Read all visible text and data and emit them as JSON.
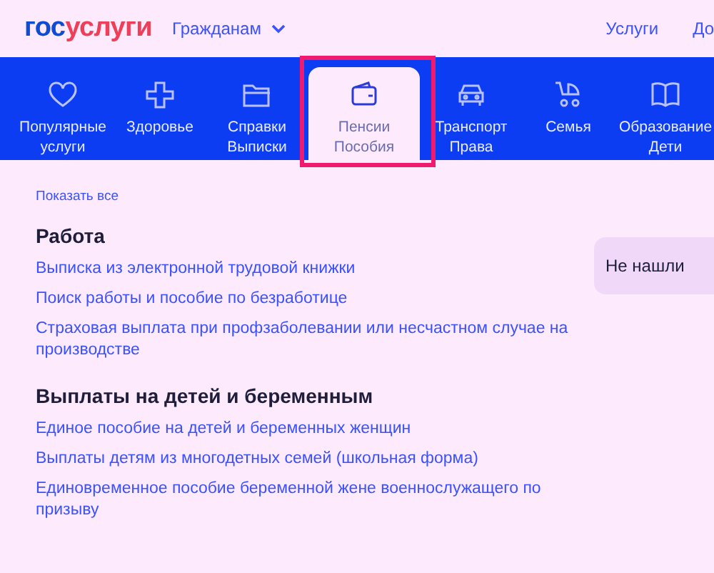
{
  "header": {
    "logo_part_1": "гос",
    "logo_part_2": "услуги",
    "audience_menu": "Гражданам",
    "nav_links": [
      "Услуги",
      "До"
    ]
  },
  "tabs": [
    {
      "kind": "heart",
      "lines": [
        "Популярные",
        "услуги"
      ],
      "selected": false
    },
    {
      "kind": "plus",
      "lines": [
        "Здоровье"
      ],
      "selected": false
    },
    {
      "kind": "folder",
      "lines": [
        "Справки",
        "Выписки"
      ],
      "selected": false
    },
    {
      "kind": "wallet",
      "lines": [
        "Пенсии",
        "Пособия"
      ],
      "selected": true,
      "highlighted": true
    },
    {
      "kind": "car",
      "lines": [
        "Транспорт",
        "Права"
      ],
      "selected": false
    },
    {
      "kind": "stroller",
      "lines": [
        "Семья"
      ],
      "selected": false
    },
    {
      "kind": "book",
      "lines": [
        "Образование",
        "Дети"
      ],
      "selected": false
    }
  ],
  "show_all": "Показать все",
  "sections": [
    {
      "title": "Работа",
      "links": [
        "Выписка из электронной трудовой книжки",
        "Поиск работы и пособие по безработице",
        "Страховая выплата при профзаболевании или несчастном случае на производстве"
      ]
    },
    {
      "title": "Выплаты на детей и беременным",
      "links": [
        "Единое пособие на детей и беременных женщин",
        "Выплаты детям из многодетных семей (школьная форма)",
        "Единовременное пособие беременной жене военнослужащего по призыву"
      ]
    }
  ],
  "help_card": "Не нашли"
}
